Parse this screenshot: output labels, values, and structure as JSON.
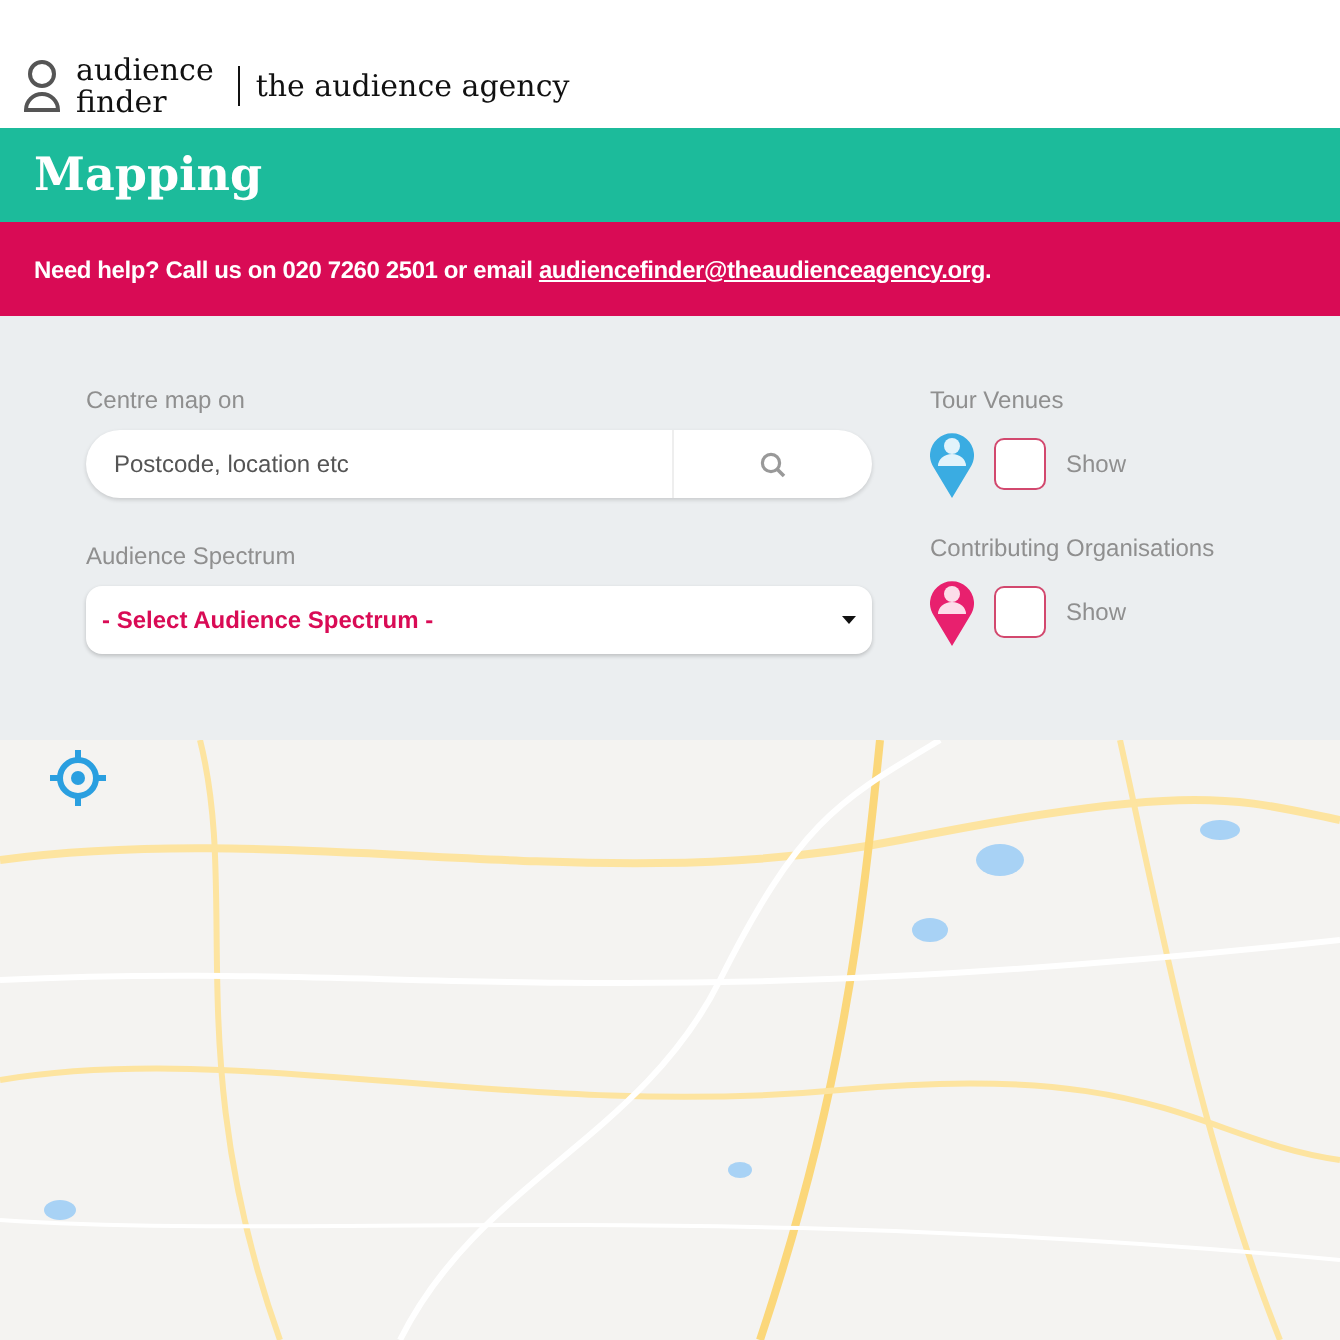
{
  "header": {
    "brand_line_1": "audience",
    "brand_line_2": "finder",
    "agency": "the audience agency"
  },
  "title": "Mapping",
  "help": {
    "text": "Need help? Call us on 020 7260 2501 or email ",
    "link": "audiencefinder@theaudienceagency.org",
    "tail": "."
  },
  "centre_map": {
    "label": "Centre map on",
    "placeholder": "Postcode, location etc"
  },
  "spectrum": {
    "label": "Audience Spectrum",
    "value": "- Select Audience Spectrum -"
  },
  "layers": [
    {
      "label": "Tour Venues",
      "color": "#3aace2",
      "checked": false,
      "option": "Show"
    },
    {
      "label": "Contributing Organisations",
      "color": "#e8206e",
      "checked": false,
      "option": "Show"
    }
  ]
}
